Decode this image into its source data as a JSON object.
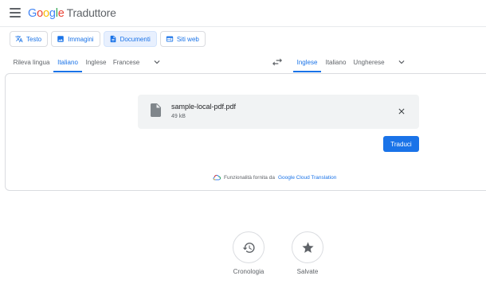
{
  "header": {
    "logo_google": [
      "G",
      "o",
      "o",
      "g",
      "l",
      "e"
    ],
    "product_name": "Traduttore"
  },
  "modes": [
    {
      "label": "Testo",
      "icon": "translate-icon",
      "active": false
    },
    {
      "label": "Immagini",
      "icon": "image-icon",
      "active": false
    },
    {
      "label": "Documenti",
      "icon": "document-icon",
      "active": true
    },
    {
      "label": "Siti web",
      "icon": "web-icon",
      "active": false
    }
  ],
  "source_langs": [
    {
      "label": "Rileva lingua",
      "active": false
    },
    {
      "label": "Italiano",
      "active": true
    },
    {
      "label": "Inglese",
      "active": false
    },
    {
      "label": "Francese",
      "active": false
    }
  ],
  "target_langs": [
    {
      "label": "Inglese",
      "active": true
    },
    {
      "label": "Italiano",
      "active": false
    },
    {
      "label": "Ungherese",
      "active": false
    }
  ],
  "file": {
    "name": "sample-local-pdf.pdf",
    "size": "49 kB"
  },
  "translate_button": "Traduci",
  "powered_by": {
    "text": "Funzionalità fornita da",
    "link": "Google Cloud Translation"
  },
  "actions": [
    {
      "label": "Cronologia",
      "icon": "history-icon"
    },
    {
      "label": "Salvate",
      "icon": "star-icon"
    }
  ],
  "colors": {
    "accent": "#1a73e8",
    "active_mode_bg": "#e8f0fe",
    "file_box_bg": "#f1f3f4"
  }
}
